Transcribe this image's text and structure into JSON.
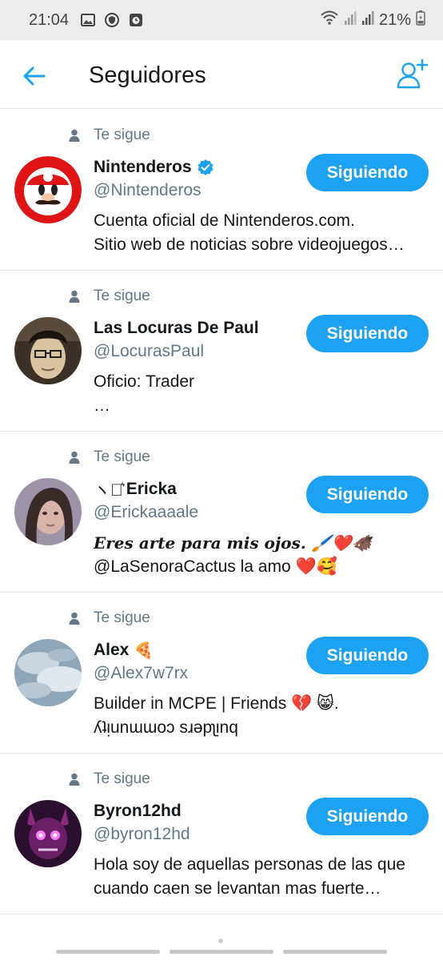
{
  "status_bar": {
    "time": "21:04",
    "battery": "21%",
    "icons": [
      "gallery-icon",
      "shield-icon",
      "alarm-icon",
      "wifi-icon",
      "signal-icon",
      "signal-icon-2",
      "battery-icon"
    ]
  },
  "header": {
    "title": "Seguidores",
    "back_icon": "arrow-left-icon",
    "add_icon": "add-user-icon"
  },
  "colors": {
    "accent": "#1da1f2",
    "muted": "#657786",
    "divider": "#e1e8ed"
  },
  "followers": [
    {
      "follows_label": "Te sigue",
      "name": "Nintenderos",
      "verified": true,
      "handle": "@Nintenderos",
      "bio": [
        "Cuenta oficial de Nintenderos.com.",
        "Sitio web de noticias sobre videojuegos…"
      ],
      "button_label": "Siguiendo"
    },
    {
      "follows_label": "Te sigue",
      "name": "Las Locuras De Paul",
      "handle": "@LocurasPaul",
      "bio": [
        "Oficio: Trader",
        "…"
      ],
      "button_label": "Siguiendo"
    },
    {
      "follows_label": "Te sigue",
      "name_prefix": "ヽ➢͛",
      "name": "Ericka",
      "handle": "@Erickaaaale",
      "bio": [
        "Eres arte para mis ojos. 🖌️❤️🐗",
        "@LaSenoraCactus la amo ❤️🥰"
      ],
      "button_label": "Siguiendo"
    },
    {
      "follows_label": "Te sigue",
      "name": "Alex",
      "name_emoji": "🍕",
      "handle": "@Alex7w7rx",
      "bio": [
        "Builder in MCPE | Friends 💔 😸.",
        "ʎʇᴉunɯɯoɔ sɹǝpʅᴉnq"
      ],
      "button_label": "Siguiendo"
    },
    {
      "follows_label": "Te sigue",
      "name": "Byron12hd",
      "handle": "@byron12hd",
      "bio": [
        "Hola soy de aquellas personas de las que",
        "cuando caen se levantan mas fuerte…"
      ],
      "button_label": "Siguiendo"
    }
  ]
}
